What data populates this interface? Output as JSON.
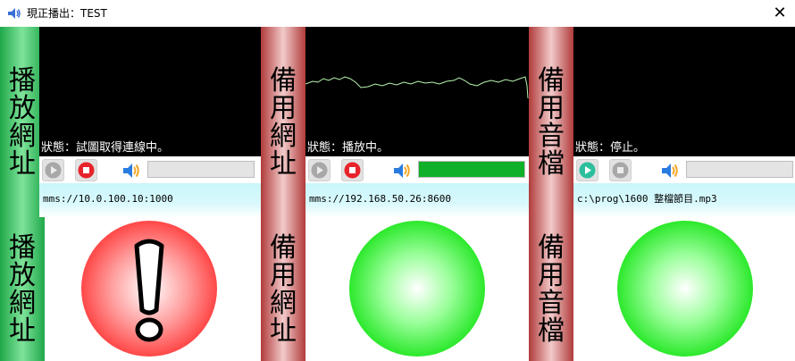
{
  "window": {
    "title": "現正播出：TEST",
    "close_glyph": "✕"
  },
  "panels": [
    {
      "id": "primary",
      "label": [
        "播",
        "放",
        "網",
        "址"
      ],
      "label_color": "#1fa84a",
      "status": "狀態：試圖取得連線中。",
      "url": "mms://10.0.100.10:1000",
      "play_icon": "play-icon",
      "play_enabled": false,
      "stop_icon": "stop-icon",
      "stop_enabled": true,
      "volume_level": 0,
      "indicator": "exclamation-red",
      "indicator_color": "#ff1f1f"
    },
    {
      "id": "backup-url",
      "label": [
        "備",
        "用",
        "網",
        "址"
      ],
      "label_color": "#b13b3b",
      "status": "狀態：播放中。",
      "url": "mms://192.168.50.26:8600",
      "play_icon": "play-icon",
      "play_enabled": false,
      "stop_icon": "stop-icon",
      "stop_enabled": true,
      "volume_level": 1.0,
      "indicator": "green-ok",
      "indicator_color": "#1ee61e"
    },
    {
      "id": "backup-audio",
      "label": [
        "備",
        "用",
        "音",
        "檔"
      ],
      "label_color": "#b13b3b",
      "status": "狀態：停止。",
      "url": "c:\\prog\\1600 整檔節目.mp3",
      "play_icon": "play-icon",
      "play_enabled": true,
      "stop_icon": "stop-icon",
      "stop_enabled": false,
      "volume_level": 0,
      "indicator": "green-ok",
      "indicator_color": "#1ee61e"
    }
  ],
  "colors": {
    "active_stop": "#e8232b",
    "active_play": "#2dbf9d",
    "disabled": "#a8a8a8",
    "volume_fill": "#10b028",
    "waveform": "#b8f5b0"
  }
}
